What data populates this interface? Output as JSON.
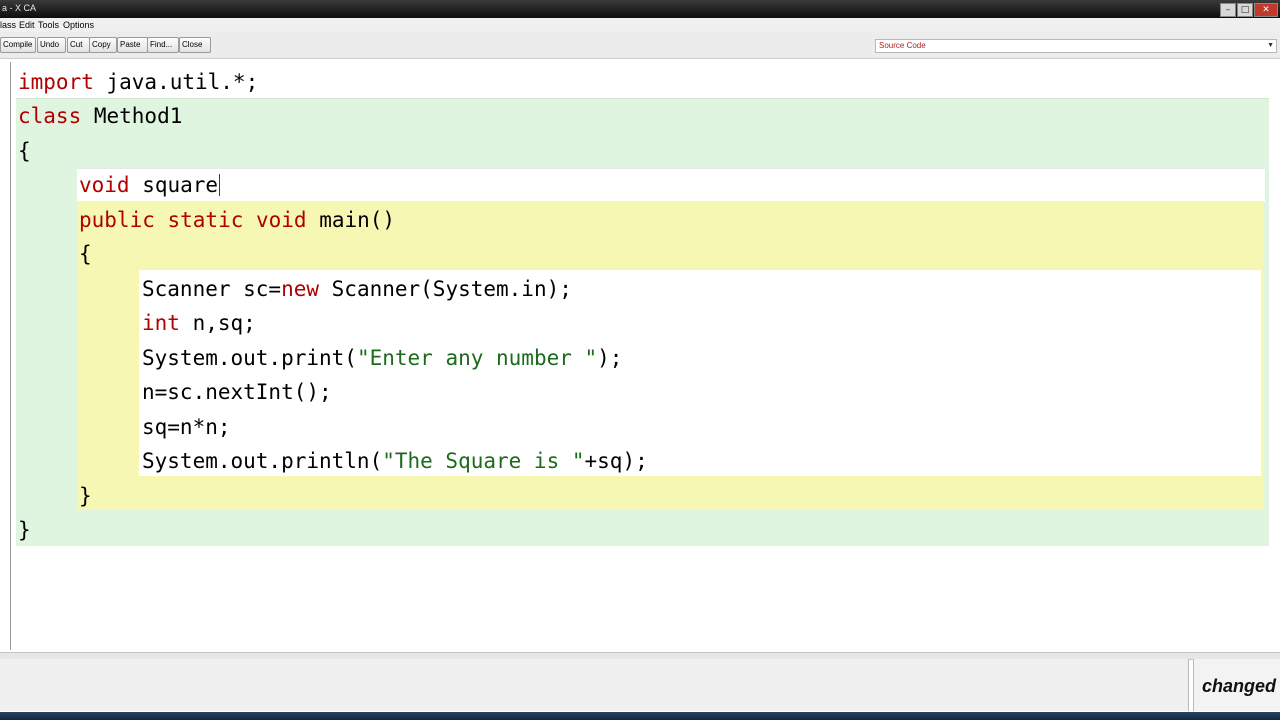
{
  "window": {
    "title": "a - X CA"
  },
  "menu": {
    "items": [
      "lass",
      "Edit",
      "Tools",
      "Options"
    ]
  },
  "toolbar": {
    "buttons": [
      "Compile",
      "Undo",
      "Cut",
      "Copy",
      "Paste",
      "Find...",
      "Close"
    ],
    "view_select": "Source Code"
  },
  "code": {
    "import_kw": "import",
    "import_rest": " java.util.*;",
    "class_kw": "class",
    "class_name": " Method1",
    "open_brace_class": "{",
    "square_kw": "void",
    "square_name": " square",
    "main_kw": "public static void",
    "main_name": " main()",
    "open_brace_main": "{",
    "line1_a": "Scanner sc=",
    "line1_kw": "new",
    "line1_b": " Scanner(System.in);",
    "line2_kw": "int",
    "line2_b": " n,sq;",
    "line3_a": "System.out.print(",
    "line3_str": "\"Enter any number \"",
    "line3_b": ");",
    "line4": "n=sc.nextInt();",
    "line5": "sq=n*n;",
    "line6_a": "System.out.println(",
    "line6_str": "\"The Square is \"",
    "line6_b": "+sq);",
    "close_brace_main": "}",
    "close_brace_class": "}"
  },
  "status": {
    "message": "changed"
  },
  "colors": {
    "keyword": "#b00000",
    "string": "#1c6a1c",
    "class_scope": "#e0f5e0",
    "method_scope": "#f7f7b4"
  }
}
